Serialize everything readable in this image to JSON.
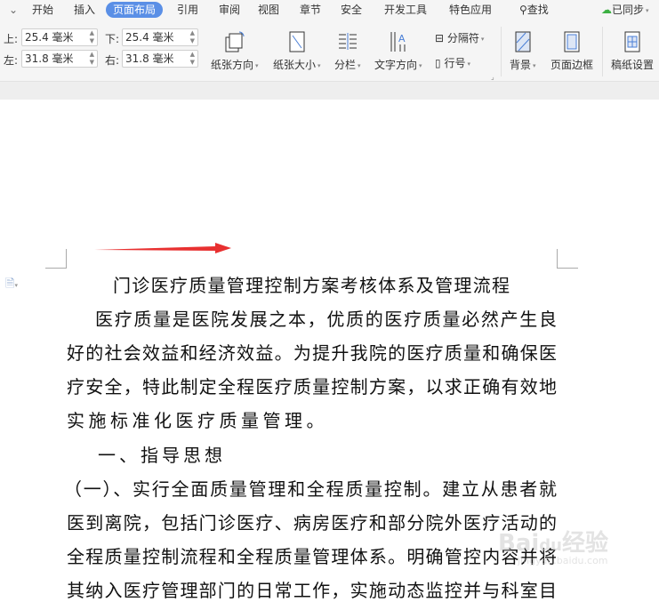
{
  "tabs": {
    "items": [
      "开始",
      "插入",
      "页面布局",
      "引用",
      "审阅",
      "视图",
      "章节",
      "安全",
      "开发工具",
      "特色应用"
    ],
    "active": "页面布局",
    "search": "查找",
    "sync": "已同步"
  },
  "margins": {
    "top_label": "上:",
    "top_value": "25.4 毫米",
    "bottom_label": "下:",
    "bottom_value": "25.4 毫米",
    "left_label": "左:",
    "left_value": "31.8 毫米",
    "right_label": "右:",
    "right_value": "31.8 毫米"
  },
  "toolbar": {
    "orientation": "纸张方向",
    "size": "纸张大小",
    "columns": "分栏",
    "text_direction": "文字方向",
    "breaks": "分隔符",
    "line_numbers": "行号",
    "background": "背景",
    "page_border": "页面边框",
    "manuscript": "稿纸设置"
  },
  "colors": {
    "accent": "#5a8fe6",
    "arrow": "#e83030",
    "sync_ok": "#3cb043"
  },
  "document": {
    "title": "门诊医疗质量管理控制方案考核体系及管理流程",
    "lines": [
      "医疗质量是医院发展之本，优质的医疗质量必然产生良",
      "好的社会效益和经济效益。为提升我院的医疗质量和确保医",
      "疗安全，特此制定全程医疗质量控制方案，以求正确有效地",
      "实施标准化医疗质量管理。",
      "一、指导思想",
      "（一）、实行全面质量管理和全程质量控制。建立从患者就",
      "医到离院，包括门诊医疗、病房医疗和部分院外医疗活动的",
      "全程质量控制流程和全程质量管理体系。明确管控内容并将",
      "其纳入医疗管理部门的日常工作，实施动态监控并与科室目"
    ]
  },
  "watermark": {
    "text": "Baidu经验",
    "url": "jingyan.baidu.com"
  }
}
